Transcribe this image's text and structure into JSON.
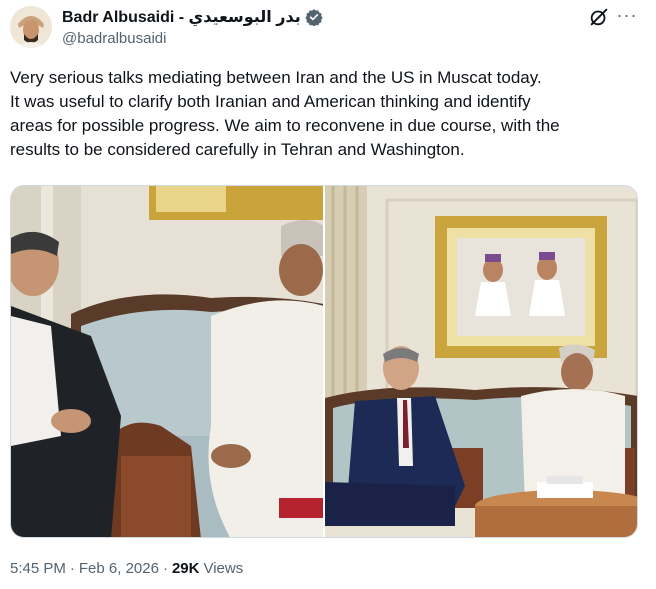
{
  "author": {
    "display_name": "Badr Albusaidi - بدر البوسعيدي",
    "handle": "@badralbusaidi",
    "verified": true,
    "avatar_icon": "avatar-photo"
  },
  "actions": {
    "grok_icon": "grok-icon",
    "more_label": "···"
  },
  "tweet": {
    "text": "Very serious talks mediating between Iran and the US in Muscat today.\nIt was useful to clarify both Iranian and American thinking and identify\nareas for possible progress. We aim to reconvene in due course, with the\nresults to be considered carefully in Tehran and Washington."
  },
  "media": {
    "photos": [
      {
        "name": "photo-iran-meeting"
      },
      {
        "name": "photo-us-meeting"
      }
    ]
  },
  "meta": {
    "time": "5:45 PM",
    "sep1": "·",
    "date": "Feb 6, 2026",
    "sep2": "·",
    "views_count": "29K",
    "views_label": "Views"
  },
  "colors": {
    "verified": "#536471",
    "text_primary": "#0f1419",
    "text_secondary": "#536471",
    "border": "#cfd9de"
  }
}
